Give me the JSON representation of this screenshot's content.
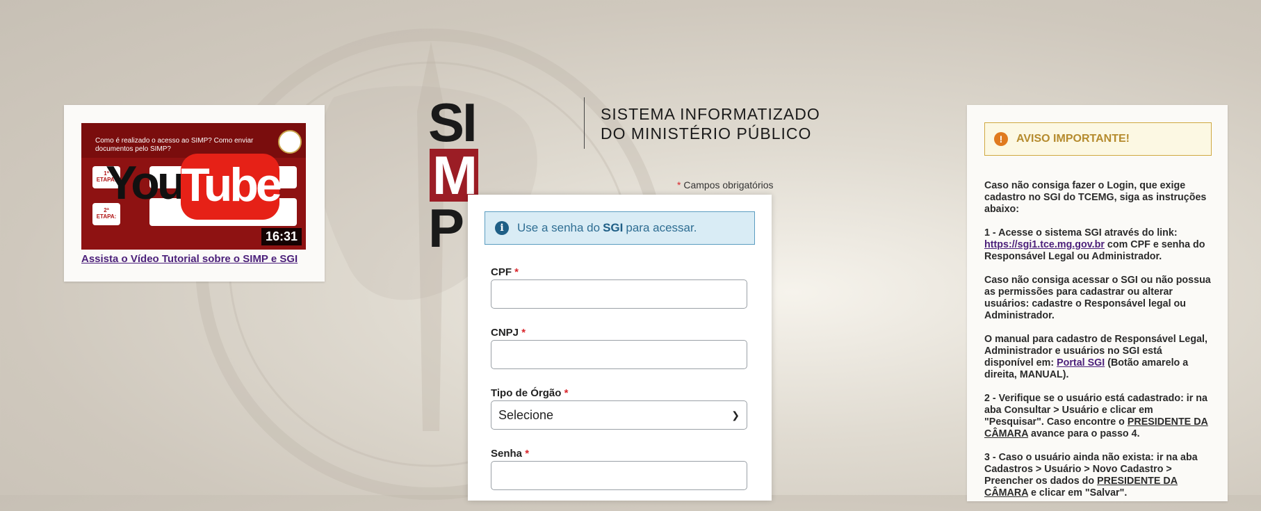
{
  "video": {
    "thumb_caption": "Como é realizado o acesso ao SIMP? Como enviar documentos pelo SIMP?",
    "step1": "1ª ETAPA:",
    "step2": "2ª ETAPA:",
    "yt_you": "You",
    "yt_tube": "Tube",
    "duration": "16:31",
    "link_text": "Assista o Vídeo Tutorial sobre o SIMP e SGI"
  },
  "logo": {
    "s": "SI",
    "m": "M",
    "p": "P",
    "line1": "SISTEMA INFORMATIZADO",
    "line2": "DO MINISTÉRIO PÚBLICO"
  },
  "form": {
    "required_mark": "*",
    "required_note": "Campos obrigatórios",
    "info_prefix": "Use a senha do",
    "info_bold": "SGI",
    "info_suffix": "para acessar.",
    "cpf_label": "CPF",
    "cpf_value": "",
    "cnpj_label": "CNPJ",
    "cnpj_value": "",
    "tipo_label": "Tipo de Órgão",
    "tipo_selected": "Selecione",
    "senha_label": "Senha",
    "senha_value": ""
  },
  "notice": {
    "title": "AVISO IMPORTANTE!",
    "p1": "Caso não consiga fazer o Login, que exige cadastro no SGI do TCEMG, siga as instruções abaixo:",
    "p2_prefix": "1 - Acesse o sistema SGI através do link:",
    "p2_link": "https://sgi1.tce.mg.gov.br",
    "p2_suffix": "com CPF e senha do Responsável Legal ou Administrador.",
    "p3": "Caso não consiga acessar o SGI ou não possua as permissões para cadastrar ou alterar usuários: cadastre o Responsável legal ou Administrador.",
    "p4_prefix": "O manual para cadastro de Responsável Legal, Administrador e usuários no SGI está disponível em:",
    "p4_link": "Portal SGI",
    "p4_suffix": "(Botão amarelo a direita, MANUAL).",
    "p5_prefix": "2 - Verifique se o usuário está cadastrado: ir na aba Consultar > Usuário e clicar em \"Pesquisar\". Caso encontre o",
    "p5_u": "PRESIDENTE DA CÂMARA",
    "p5_suffix": "avance para o passo 4.",
    "p6_prefix": "3 - Caso o usuário ainda não exista: ir na aba Cadastros > Usuário > Novo Cadastro > Preencher os dados do",
    "p6_u": "PRESIDENTE DA CÂMARA",
    "p6_suffix": "e clicar em \"Salvar\"."
  },
  "colors": {
    "brand_red": "#9b1d25",
    "info_blue": "#2f6e93",
    "warning_gold": "#b58b2e",
    "link_purple": "#4b1f7a",
    "required_red": "#d9262c"
  },
  "icons": {
    "info": "info-circle-icon",
    "warning": "exclamation-circle-icon",
    "select": "chevron-down-icon"
  }
}
